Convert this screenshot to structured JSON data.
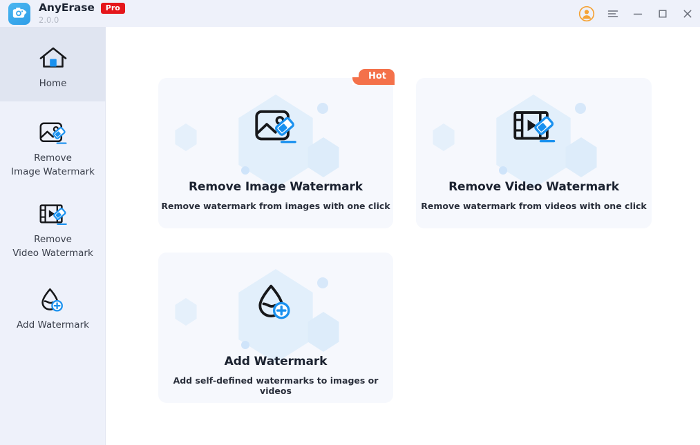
{
  "titlebar": {
    "logo_icon": "camera-eraser-logo-icon",
    "app_name": "AnyErase",
    "pro_badge": "Pro",
    "version": "2.0.0",
    "controls": [
      {
        "name": "user-account-icon",
        "label": ""
      },
      {
        "name": "hamburger-menu-icon",
        "label": ""
      },
      {
        "name": "minimize-icon",
        "label": ""
      },
      {
        "name": "maximize-icon",
        "label": ""
      },
      {
        "name": "close-icon",
        "label": ""
      }
    ],
    "background": "#eef1fa",
    "pro_color": "#e5161b",
    "avatar_color": "#f5a336"
  },
  "sidebar": {
    "background": "#eef1fa",
    "active_background": "#e0e5f1",
    "items": [
      {
        "id": "home",
        "label": "Home",
        "icon": "home-icon",
        "active": true
      },
      {
        "id": "image",
        "label": "Remove\nImage Watermark",
        "line1": "Remove",
        "line2": "Image Watermark",
        "icon": "image-eraser-icon",
        "active": false
      },
      {
        "id": "video",
        "label": "Remove\nVideo Watermark",
        "line1": "Remove",
        "line2": "Video Watermark",
        "icon": "video-eraser-icon",
        "active": false
      },
      {
        "id": "add",
        "label": "Add Watermark",
        "line1": "Add Watermark",
        "line2": "",
        "icon": "droplet-plus-icon",
        "active": false
      }
    ]
  },
  "main": {
    "cards": [
      {
        "id": "image",
        "title": "Remove Image Watermark",
        "subtitle": "Remove watermark from images with one click",
        "icon": "image-eraser-icon",
        "badge": "Hot",
        "badge_color": "#f4714a"
      },
      {
        "id": "video",
        "title": "Remove Video Watermark",
        "subtitle": "Remove watermark from videos with one click",
        "icon": "video-eraser-icon",
        "badge": "",
        "badge_color": ""
      },
      {
        "id": "add",
        "title": "Add Watermark",
        "subtitle": "Add self-defined watermarks to images or videos",
        "icon": "droplet-plus-icon",
        "badge": "",
        "badge_color": ""
      }
    ],
    "card_background": "#f6f8fd",
    "accent_blue": "#1a91ef"
  }
}
